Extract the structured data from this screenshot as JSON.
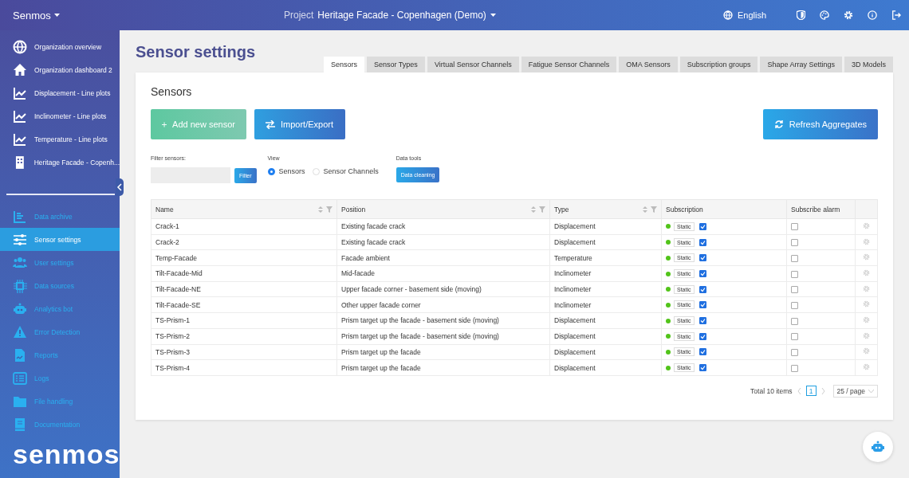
{
  "brand": "Senmos",
  "project": {
    "label": "Project",
    "name": "Heritage Facade - Copenhagen (Demo)"
  },
  "language": "English",
  "sidebar": {
    "pinned_items": [
      {
        "label": "Organization overview"
      },
      {
        "label": "Organization dashboard 2"
      },
      {
        "label": "Displacement - Line plots"
      },
      {
        "label": "Inclinometer - Line plots"
      },
      {
        "label": "Temperature - Line plots"
      },
      {
        "label": "Heritage Facade - Copenh..."
      }
    ],
    "menu_items": [
      {
        "label": "Data archive",
        "selected": false
      },
      {
        "label": "Sensor settings",
        "selected": true
      },
      {
        "label": "User settings",
        "selected": false
      },
      {
        "label": "Data sources",
        "selected": false
      },
      {
        "label": "Analytics bot",
        "selected": false
      },
      {
        "label": "Error Detection",
        "selected": false
      },
      {
        "label": "Reports",
        "selected": false
      },
      {
        "label": "Logs",
        "selected": false
      },
      {
        "label": "File handling",
        "selected": false
      },
      {
        "label": "Documentation",
        "selected": false
      }
    ]
  },
  "page_title": "Sensor settings",
  "tabs": [
    {
      "label": "Sensors",
      "selected": true
    },
    {
      "label": "Sensor Types",
      "selected": false
    },
    {
      "label": "Virtual Sensor Channels",
      "selected": false
    },
    {
      "label": "Fatigue Sensor Channels",
      "selected": false
    },
    {
      "label": "OMA Sensors",
      "selected": false
    },
    {
      "label": "Subscription groups",
      "selected": false
    },
    {
      "label": "Shape Array Settings",
      "selected": false
    },
    {
      "label": "3D Models",
      "selected": false
    }
  ],
  "card_title": "Sensors",
  "buttons": {
    "add": "Add new sensor",
    "import": "Import/Export",
    "refresh": "Refresh Aggregates"
  },
  "filter": {
    "label": "Filter sensors:",
    "button": "Filter"
  },
  "view": {
    "label": "View",
    "options": [
      {
        "label": "Sensors",
        "selected": true
      },
      {
        "label": "Sensor Channels",
        "selected": false
      }
    ]
  },
  "data_tools": {
    "label": "Data tools",
    "button": "Data cleaning"
  },
  "table": {
    "columns": [
      "Name",
      "Position",
      "Type",
      "Subscription",
      "Subscribe alarm"
    ],
    "rows": [
      {
        "name": "Crack-1",
        "position": "Existing facade crack",
        "type": "Displacement",
        "color": "#52c41a",
        "subscription": "Static",
        "subscribed": true,
        "alarm": false
      },
      {
        "name": "Crack-2",
        "position": "Existing facade crack",
        "type": "Displacement",
        "color": "#52c41a",
        "subscription": "Static",
        "subscribed": true,
        "alarm": false
      },
      {
        "name": "Temp-Facade",
        "position": "Facade ambient",
        "type": "Temperature",
        "color": "#52c41a",
        "subscription": "Static",
        "subscribed": true,
        "alarm": false
      },
      {
        "name": "Tilt-Facade-Mid",
        "position": "Mid-facade",
        "type": "Inclinometer",
        "color": "#52c41a",
        "subscription": "Static",
        "subscribed": true,
        "alarm": false
      },
      {
        "name": "Tilt-Facade-NE",
        "position": "Upper facade corner - basement side (moving)",
        "type": "Inclinometer",
        "color": "#52c41a",
        "subscription": "Static",
        "subscribed": true,
        "alarm": false
      },
      {
        "name": "Tilt-Facade-SE",
        "position": "Other upper facade corner",
        "type": "Inclinometer",
        "color": "#52c41a",
        "subscription": "Static",
        "subscribed": true,
        "alarm": false
      },
      {
        "name": "TS-Prism-1",
        "position": "Prism target up the facade - basement side (moving)",
        "type": "Displacement",
        "color": "#52c41a",
        "subscription": "Static",
        "subscribed": true,
        "alarm": false
      },
      {
        "name": "TS-Prism-2",
        "position": "Prism target up the facade - basement side (moving)",
        "type": "Displacement",
        "color": "#52c41a",
        "subscription": "Static",
        "subscribed": true,
        "alarm": false
      },
      {
        "name": "TS-Prism-3",
        "position": "Prism target up the facade",
        "type": "Displacement",
        "color": "#52c41a",
        "subscription": "Static",
        "subscribed": true,
        "alarm": false
      },
      {
        "name": "TS-Prism-4",
        "position": "Prism target up the facade",
        "type": "Displacement",
        "color": "#52c41a",
        "subscription": "Static",
        "subscribed": true,
        "alarm": false
      }
    ]
  },
  "pagination": {
    "total": "Total 10 items",
    "pages": [
      {
        "label": "1",
        "selected": true
      }
    ],
    "page_size": "25 / page"
  },
  "logo": "senmos"
}
